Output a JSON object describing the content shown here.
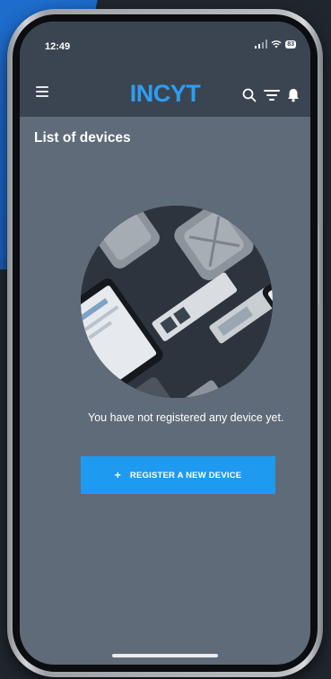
{
  "status_bar": {
    "time": "12:49",
    "battery": "83"
  },
  "app_bar": {
    "brand": "INCYT",
    "brand_color": "#2e9df0"
  },
  "page": {
    "title": "List of devices",
    "empty_message": "You have not registered any device yet.",
    "register_button_label": "REGISTER A NEW DEVICE",
    "register_button_icon": "+"
  },
  "colors": {
    "screen_bg": "#5f6b79",
    "header_bg": "#3b4552",
    "primary_button": "#1e9bf0"
  }
}
